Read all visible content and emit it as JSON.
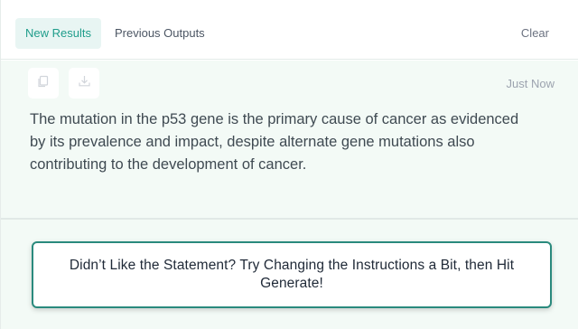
{
  "tabs": {
    "new_results": "New Results",
    "previous_outputs": "Previous Outputs"
  },
  "clear_label": "Clear",
  "output": {
    "timestamp": "Just Now",
    "statement": "The mutation in the p53 gene is the primary cause of cancer as evidenced by its prevalence and impact, despite alternate gene mutations also contributing to the development of cancer.",
    "actions": [
      "copy-icon",
      "download-icon"
    ]
  },
  "hint": "Didn’t Like the Statement? Try Changing the Instructions a Bit, then Hit Generate!",
  "colors": {
    "accent": "#1f9d8b",
    "accent_bg": "#e8f5f3",
    "panel_bg": "#f3faf6",
    "hint_border": "#2a8a7d"
  }
}
